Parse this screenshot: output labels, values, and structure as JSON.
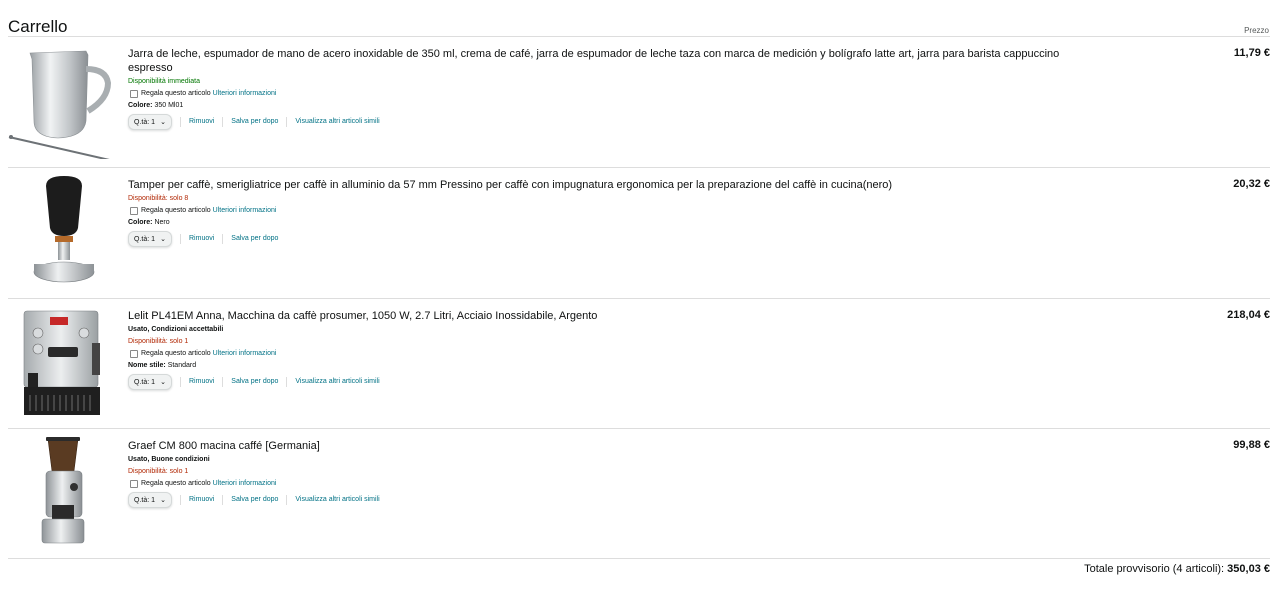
{
  "page": {
    "title": "Carrello",
    "price_header": "Prezzo"
  },
  "items": [
    {
      "title": "Jarra de leche, espumador de mano de acero inoxidable de 350 ml, crema de café, jarra de espumador de leche taza con marca de medición y bolígrafo latte art, jarra para barista cappuccino espresso",
      "condition": "",
      "availability": "Disponibilità immediata",
      "gift_label": "Regala questo articolo",
      "gift_link": "Ulteriori informazioni",
      "attr_name": "Colore:",
      "attr_value": "350 Ml01",
      "qty_label": "Q.tà: 1",
      "remove": "Rimuovi",
      "save": "Salva per dopo",
      "similar": "Visualizza altri articoli simili",
      "price": "11,79 €",
      "image_icon": "milk-pitcher-image"
    },
    {
      "title": "Tamper per caffè, smerigliatrice per caffè in alluminio da 57 mm Pressino per caffè con impugnatura ergonomica per la preparazione del caffè in cucina(nero)",
      "condition": "",
      "availability": "Disponibilità: solo 8",
      "gift_label": "Regala questo articolo",
      "gift_link": "Ulteriori informazioni",
      "attr_name": "Colore:",
      "attr_value": "Nero",
      "qty_label": "Q.tà: 1",
      "remove": "Rimuovi",
      "save": "Salva per dopo",
      "similar": "",
      "price": "20,32 €",
      "image_icon": "coffee-tamper-image"
    },
    {
      "title": "Lelit PL41EM Anna, Macchina da caffè prosumer, 1050 W, 2.7 Litri, Acciaio Inossidabile, Argento",
      "condition": "Usato, Condizioni accettabili",
      "availability": "Disponibilità: solo 1",
      "gift_label": "Regala questo articolo",
      "gift_link": "Ulteriori informazioni",
      "attr_name": "Nome stile:",
      "attr_value": "Standard",
      "qty_label": "Q.tà: 1",
      "remove": "Rimuovi",
      "save": "Salva per dopo",
      "similar": "Visualizza altri articoli simili",
      "price": "218,04 €",
      "image_icon": "espresso-machine-image"
    },
    {
      "title": "Graef CM 800 macina caffé [Germania]",
      "condition": "Usato, Buone condizioni",
      "availability": "Disponibilità: solo 1",
      "gift_label": "Regala questo articolo",
      "gift_link": "Ulteriori informazioni",
      "attr_name": "",
      "attr_value": "",
      "qty_label": "Q.tà: 1",
      "remove": "Rimuovi",
      "save": "Salva per dopo",
      "similar": "Visualizza altri articoli simili",
      "price": "99,88 €",
      "image_icon": "coffee-grinder-image"
    }
  ],
  "subtotal": {
    "label": "Totale provvisorio (4 articoli):",
    "value": "350,03 €"
  },
  "colors": {
    "link": "#007185",
    "in_stock": "#007600",
    "low_stock": "#b12704",
    "divider": "#dddddd"
  }
}
